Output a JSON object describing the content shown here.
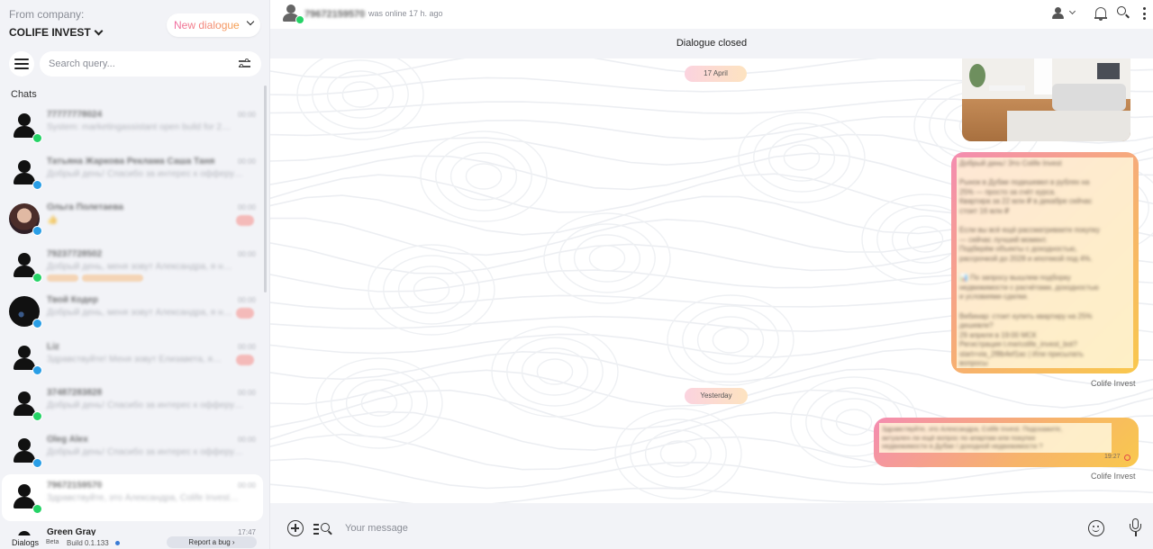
{
  "sidebar": {
    "from_company_label": "From company:",
    "company_name": "COLIFE INVEST",
    "new_dialogue_label": "New dialogue",
    "search_placeholder": "Search query...",
    "chats_title": "Chats",
    "chats": [
      {
        "name": "77777778024",
        "time": "00:00",
        "preview": "System: marketingassistant open build for 2…",
        "avatar": "person",
        "channel": "wa"
      },
      {
        "name": "Татьяна Жаркова Реклама Саша Таня",
        "time": "00:00",
        "preview": "Добрый день! Спасибо за интерес к офферу…",
        "avatar": "person",
        "channel": "tg"
      },
      {
        "name": "Ольга Полетаева",
        "time": "00:00",
        "preview": "👍",
        "avatar": "photo",
        "channel": "tg",
        "count": "1"
      },
      {
        "name": "79237728502",
        "time": "00:00",
        "preview": "Добрый день, меня зовут Александра, я н…",
        "avatar": "person",
        "channel": "wa",
        "tags": true
      },
      {
        "name": "Твой Кодер",
        "time": "00:00",
        "preview": "Добрый день, меня зовут Александра, я н…",
        "avatar": "photo2",
        "channel": "tg",
        "count": "1"
      },
      {
        "name": "Liz",
        "time": "00:00",
        "preview": "Здравствуйте! Меня зовут Елизавета, я…",
        "avatar": "person",
        "channel": "tg",
        "count": "1"
      },
      {
        "name": "37487283828",
        "time": "00:00",
        "preview": "Добрый день! Спасибо за интерес к офферу…",
        "avatar": "person",
        "channel": "wa"
      },
      {
        "name": "Oleg Alex",
        "time": "00:00",
        "preview": "Добрый день! Спасибо за интерес к офферу…",
        "avatar": "person",
        "channel": "tg"
      },
      {
        "name": "79672159570",
        "time": "00:00",
        "preview": "Здравствуйте, это Александра, Colife Invest…",
        "avatar": "person",
        "channel": "wa",
        "active": true
      },
      {
        "name": "Green Gray",
        "time": "17:47",
        "preview": "",
        "avatar": "person",
        "channel": "wa",
        "clear": true
      }
    ],
    "bottom": {
      "dialogs_label": "Dialogs",
      "beta_label": "Beta",
      "build_label": "Build 0.1.133",
      "report_bug_label": "Report a bug ›"
    }
  },
  "header": {
    "contact_phone": "79672159570",
    "status": "was online 17 h. ago"
  },
  "banner": {
    "text": "Dialogue closed"
  },
  "conversation": {
    "date_pills": [
      "17 April",
      "Yesterday"
    ],
    "messages": [
      {
        "type": "image",
        "alt": "living room photo"
      },
      {
        "type": "text",
        "text": "Добрый день! Это Colife Invest\n\nРынок в Дубае подешевел в рублях на\n25% — просто за счёт курса.\nКвартира за 22 млн ₽ в декабре сейчас\nстоит 16 млн ₽\n\nЕсли вы всё ещё рассматриваете покупку\n— сейчас лучший момент.\nПодберём объекты с доходностью,\nрассрочкой до 2028 и ипотекой под 4%.\n\n📊 По запросу вышлем подборку\nнедвижимости с расчётами, доходностью\nи условиями сделки.\n\nВебинар: стоит купить квартиру на 25%\nдешевле?\n29 апреля в 19:00 МСК\nРегистрация t.me/colife_invest_bot?\nstart=via_2f8b4ef1ac | Или присылать\nвопросы",
        "sender": "Colife Invest"
      },
      {
        "type": "text",
        "text": "Здравствуйте, это Александра, Colife Invest. Подскажите,\nактуален ли ещё вопрос по апартам или покупке\nнедвижимости в Дубае / доходной недвижимости ?",
        "time": "19:27",
        "sender": "Colife Invest"
      }
    ]
  },
  "composer": {
    "placeholder": "Your message"
  },
  "colors": {
    "whatsapp": "#25d366",
    "telegram": "#2a9ee6",
    "bubble_gradient_start": "#f48cb1",
    "bubble_gradient_end": "#f9c84d",
    "app_background": "#f2f3f7"
  }
}
